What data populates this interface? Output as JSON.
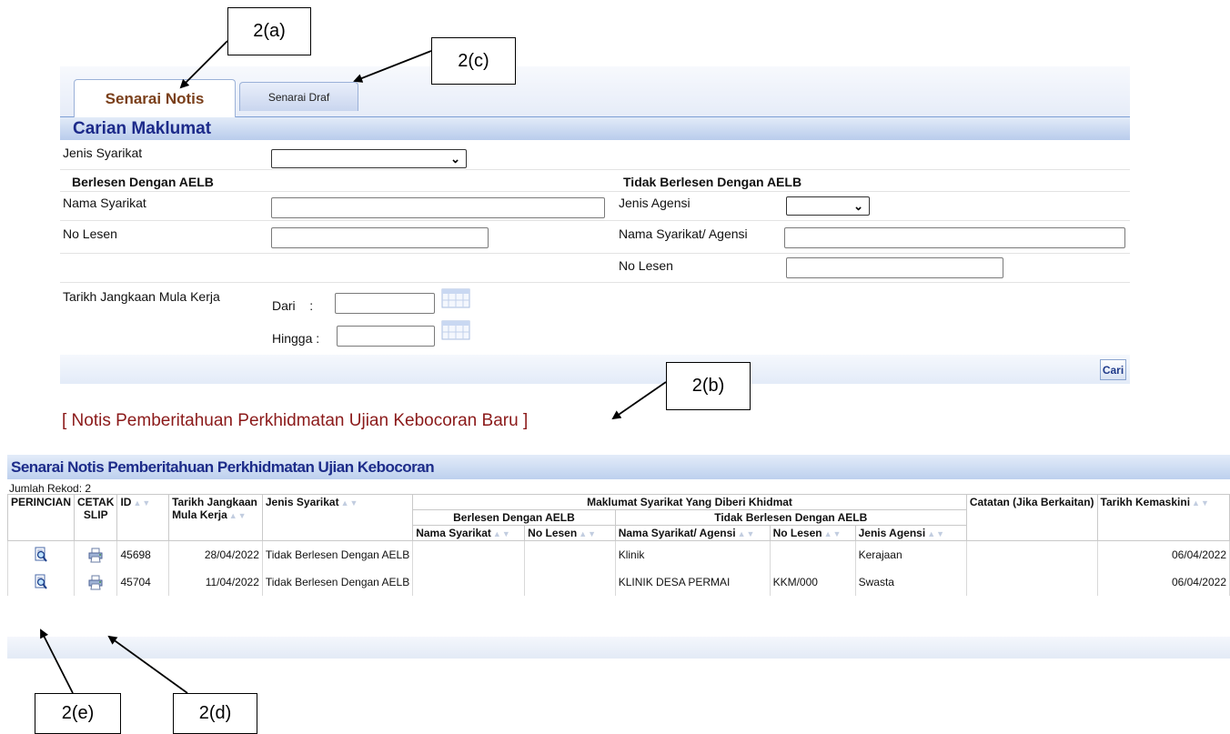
{
  "callouts": {
    "a": "2(a)",
    "b": "2(b)",
    "c": "2(c)",
    "d": "2(d)",
    "e": "2(e)"
  },
  "tabs": {
    "notis": "Senarai Notis",
    "draf": "Senarai Draf"
  },
  "search": {
    "title": "Carian Maklumat",
    "jenis_syarikat_label": "Jenis Syarikat",
    "jenis_syarikat_value": "",
    "berlesen_heading": "Berlesen Dengan AELB",
    "tidak_berlesen_heading": "Tidak Berlesen Dengan AELB",
    "nama_syarikat_label": "Nama Syarikat",
    "nama_syarikat_value": "",
    "no_lesen_label": "No Lesen",
    "no_lesen_value": "",
    "jenis_agensi_label": "Jenis Agensi",
    "jenis_agensi_value": "",
    "nama_agensi_label": "Nama Syarikat/ Agensi",
    "nama_agensi_value": "",
    "no_lesen2_label": "No Lesen",
    "no_lesen2_value": "",
    "tarikh_label": "Tarikh Jangkaan Mula Kerja",
    "dari_label": "Dari    :",
    "hingga_label": "Hingga :",
    "dari_value": "",
    "hingga_value": "",
    "cari_button": "Cari"
  },
  "new_notice_link": "[ Notis Pemberitahuan Perkhidmatan Ujian Kebocoran Baru ]",
  "results": {
    "title": "Senarai Notis Pemberitahuan Perkhidmatan Ujian Kebocoran",
    "count": "Jumlah Rekod: 2",
    "headers": {
      "perincian": "PERINCIAN",
      "cetak": "CETAK",
      "slip": "SLIP",
      "id": "ID",
      "tarikh1": "Tarikh Jangkaan",
      "tarikh2": "Mula Kerja",
      "jenis_syarikat": "Jenis Syarikat",
      "maklumat": "Maklumat Syarikat Yang Diberi Khidmat",
      "berlesen": "Berlesen Dengan AELB",
      "tidak_berlesen": "Tidak Berlesen Dengan AELB",
      "nama_syarikat": "Nama Syarikat",
      "no_lesen": "No Lesen",
      "nama_agensi": "Nama Syarikat/ Agensi",
      "no_lesen2": "No Lesen",
      "jenis_agensi": "Jenis Agensi",
      "catatan": "Catatan (Jika Berkaitan)",
      "tarikh_kemaskini": "Tarikh Kemaskini"
    },
    "rows": [
      {
        "id": "45698",
        "tarikh": "28/04/2022",
        "jenis": "Tidak Berlesen Dengan AELB",
        "nama_syarikat": "",
        "no_lesen": "",
        "nama_agensi": "Klinik",
        "no_lesen2": "",
        "jenis_agensi": "Kerajaan",
        "catatan": "",
        "kemaskini": "06/04/2022"
      },
      {
        "id": "45704",
        "tarikh": "11/04/2022",
        "jenis": "Tidak Berlesen Dengan AELB",
        "nama_syarikat": "",
        "no_lesen": "",
        "nama_agensi": "KLINIK DESA PERMAI",
        "no_lesen2": "KKM/000",
        "jenis_agensi": "Swasta",
        "catatan": "",
        "kemaskini": "06/04/2022"
      }
    ]
  },
  "icons": {
    "perincian": "magnifier-document-icon",
    "cetak": "printer-icon",
    "calendar": "calendar-icon",
    "sort": "sort-arrows-icon"
  },
  "colors": {
    "header_blue": "#1c2a8a",
    "link_red": "#8b1a1a",
    "tab_active_text": "#7a3f1a",
    "panel_gradient_top": "#e2ebf8",
    "panel_gradient_bottom": "#b9ccec"
  }
}
